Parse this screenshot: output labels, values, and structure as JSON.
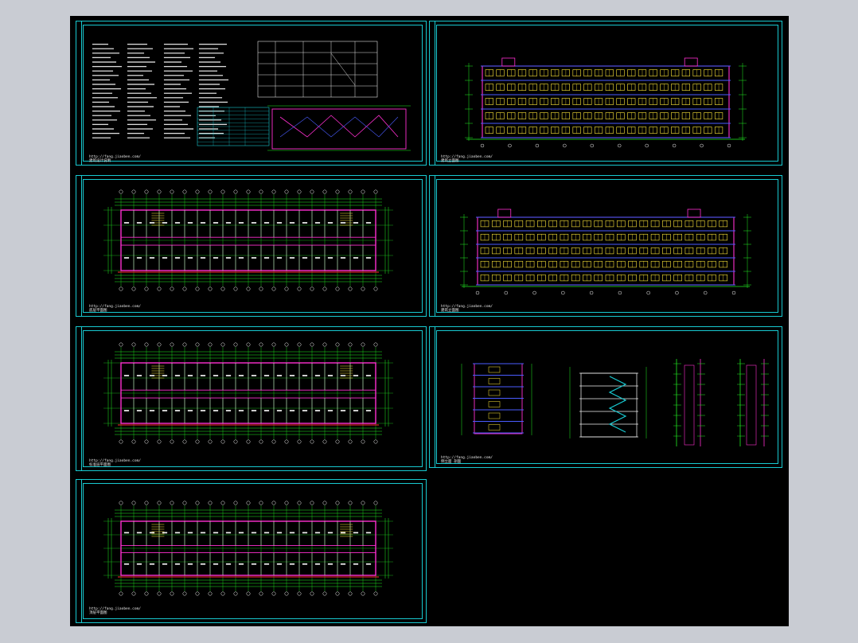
{
  "viewer": {
    "background_color": "#c9ccd3",
    "canvas_color": "#000000",
    "frame_color": "#18c9d0"
  },
  "sheets": [
    {
      "id": "design-notes",
      "credit_url": "http://fang.jiaoben.com/",
      "credit_note": "建筑设计说明"
    },
    {
      "id": "front-elevation",
      "credit_url": "http://fang.jiaoben.com/",
      "credit_note": "建筑立面图"
    },
    {
      "id": "ground-floor-plan",
      "credit_url": "http://fang.jiaoben.com/",
      "credit_note": "底层平面图"
    },
    {
      "id": "rear-elevation",
      "credit_url": "http://fang.jiaoben.com/",
      "credit_note": "建筑立面图"
    },
    {
      "id": "standard-floor-plan",
      "credit_url": "http://fang.jiaoben.com/",
      "credit_note": "标准层平面图"
    },
    {
      "id": "side-elevations-sections",
      "credit_url": "http://fang.jiaoben.com/",
      "credit_note": "侧立面 剖面"
    },
    {
      "id": "top-floor-plan",
      "credit_url": "http://fang.jiaoben.com/",
      "credit_note": "顶层平面图"
    }
  ],
  "colors": {
    "wall": "#ff2fd0",
    "window": "#ffe83a",
    "dimension": "#22ee22",
    "axis": "#f0f0f0",
    "slab": "#4a5cff",
    "accent_red": "#ff2a2a",
    "cyan": "#18c9d0"
  }
}
